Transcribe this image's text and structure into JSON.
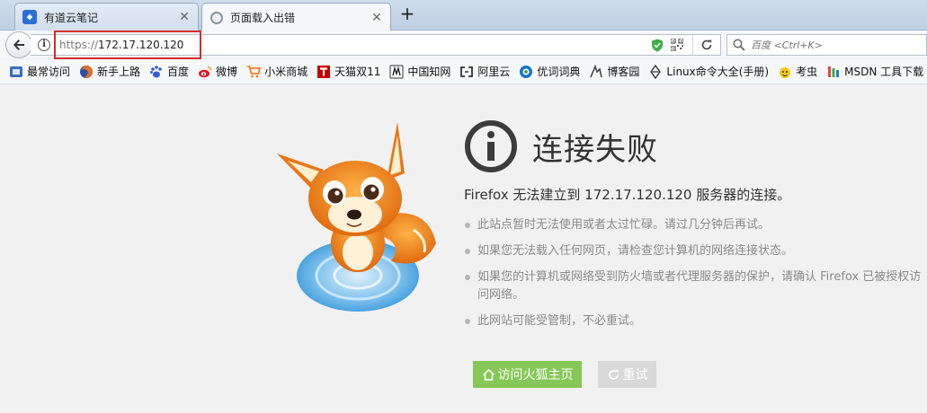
{
  "tabs": [
    {
      "label": "有道云笔记",
      "icon": "note-icon"
    },
    {
      "label": "页面载入出错",
      "icon": "loading-icon"
    }
  ],
  "tab_close": "✕",
  "new_tab": "+",
  "address": {
    "scheme": "https://",
    "host": "172.17.120.120"
  },
  "search": {
    "placeholder": "百度 <Ctrl+K>"
  },
  "bookmarks": [
    {
      "label": "最常访问",
      "icon": "most-visited-icon",
      "color": "#3a6fb8"
    },
    {
      "label": "新手上路",
      "icon": "firefox-icon",
      "color": "#e8701a"
    },
    {
      "label": "百度",
      "icon": "baidu-paw-icon",
      "color": "#2f5fd8"
    },
    {
      "label": "微博",
      "icon": "weibo-icon",
      "color": "#e6162d"
    },
    {
      "label": "小米商城",
      "icon": "cart-icon",
      "color": "#ff6a00"
    },
    {
      "label": "天猫双11",
      "icon": "tmall-icon",
      "color": "#c40000"
    },
    {
      "label": "中国知网",
      "icon": "cnki-icon",
      "color": "#333333"
    },
    {
      "label": "阿里云",
      "icon": "aliyun-icon",
      "color": "#ff6a00"
    },
    {
      "label": "优词词典",
      "icon": "dictionary-icon",
      "color": "#1a73c9"
    },
    {
      "label": "博客园",
      "icon": "cnblogs-icon",
      "color": "#444444"
    },
    {
      "label": "Linux命令大全(手册)",
      "icon": "linux-diamond-icon",
      "color": "#333333"
    },
    {
      "label": "考虫",
      "icon": "kaochong-icon",
      "color": "#f5c518"
    },
    {
      "label": "MSDN 工具下载",
      "icon": "msdn-icon",
      "color": "#e04a3f"
    }
  ],
  "error": {
    "title": "连接失败",
    "summary": "Firefox 无法建立到 172.17.120.120 服务器的连接。",
    "reasons": [
      "此站点暂时无法使用或者太过忙碌。请过几分钟后再试。",
      "如果您无法载入任何网页，请检查您计算机的网络连接状态。",
      "如果您的计算机或网络受到防火墙或者代理服务器的保护，请确认 Firefox 已被授权访问网络。",
      "此网站可能受管制，不必重试。"
    ],
    "home_button": "访问火狐主页",
    "retry_button": "重试"
  },
  "colors": {
    "accent_green": "#86c857",
    "retry_gray": "#d9d9d9",
    "highlight_red": "#d62b2b"
  }
}
